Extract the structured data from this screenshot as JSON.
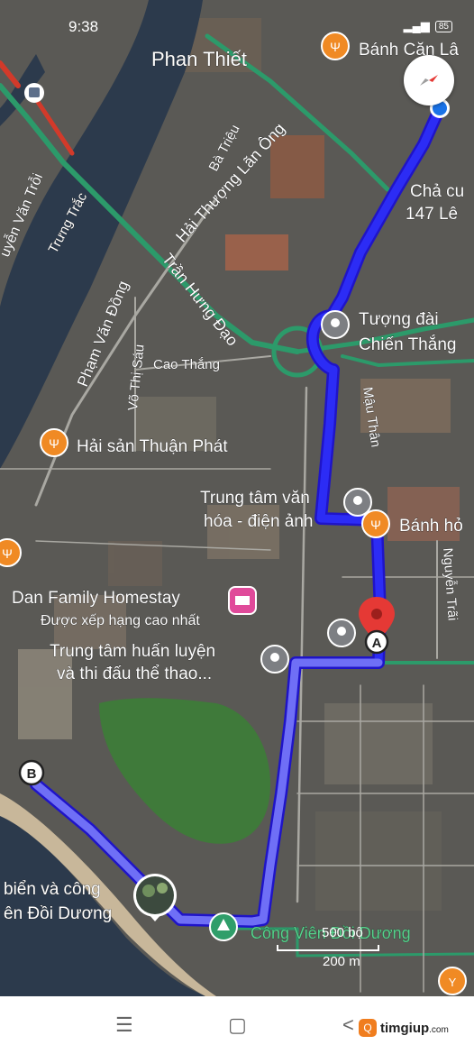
{
  "status_bar": {
    "time": "9:38",
    "battery": "85"
  },
  "map": {
    "city_label": "Phan Thiết",
    "streets": {
      "nguyen_van_troi": "uyễn Văn Trỗi",
      "trung_trac": "Trưng Trắc",
      "ba_trieu": "Bà Triệu",
      "hai_thuong_lan_ong": "Hải Thượng Lãn Ông",
      "tran_hung_dao": "Trần Hưng Đạo",
      "pham_van_dong": "Phạm Văn Đồng",
      "vo_thi_sau": "Võ Thị Sáu",
      "cao_thang": "Cao Thắng",
      "mau_than": "Mậu Thân",
      "nguyen_trai": "Nguyễn Trãi"
    },
    "places": {
      "banh_can": "Bánh Căn Lâ",
      "cha_cua_1": "Chả cu",
      "cha_cua_2": "147 Lê",
      "tuong_dai_1": "Tượng đài",
      "tuong_dai_2": "Chiến Thắng",
      "hai_san": "Hải sản Thuận Phát",
      "trung_tam_van_hoa_1": "Trung tâm văn",
      "trung_tam_van_hoa_2": "hóa - điện ảnh",
      "banh_hoi": "Bánh hỏ",
      "homestay_name": "Dan Family Homestay",
      "homestay_rating": "Được xếp hạng cao nhất",
      "trung_tam_huan_luyen_1": "Trung tâm huấn luyện",
      "trung_tam_huan_luyen_2": "và thi đấu thể thao...",
      "bai_bien_1": "biển và công",
      "bai_bien_2": "ên Đồi Dương",
      "cong_vien": "Công Viên Đồi Dương"
    },
    "markers": {
      "start": "A",
      "end": "B"
    },
    "scale": {
      "label_top": "500 bộ",
      "label_bottom": "200 m"
    },
    "colors": {
      "route": "#2c2cf5",
      "route_outline": "#1f14c8",
      "route_light": "#6f6ff6",
      "water": "#2c3a4c",
      "park": "#3f7a3a",
      "major_road": "#2c9a6a",
      "traffic_red": "#d23a2a",
      "poi_orange": "#f08a24",
      "poi_gray": "#7d7f83",
      "destination_red": "#e53935",
      "label_white": "#ffffff",
      "label_green": "#58d18c"
    }
  },
  "nav_bar": {
    "menu": "☰",
    "home": "▢",
    "back": "<"
  },
  "watermark": {
    "logo": "Q",
    "brand": "timgiup",
    "suffix": ".com"
  }
}
